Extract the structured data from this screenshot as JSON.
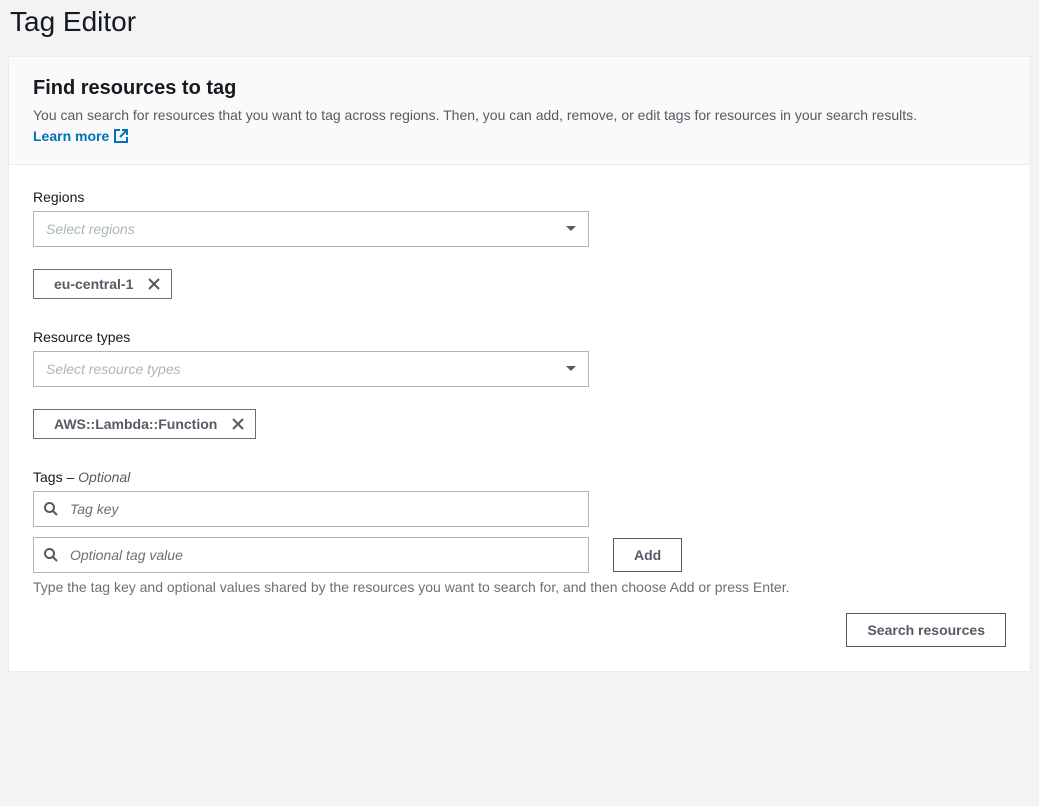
{
  "page": {
    "title": "Tag Editor"
  },
  "header": {
    "title": "Find resources to tag",
    "description": "You can search for resources that you want to tag across regions. Then, you can add, remove, or edit tags for resources in your search results.",
    "learn_more_label": "Learn more"
  },
  "regions": {
    "label": "Regions",
    "placeholder": "Select regions",
    "chips": [
      "eu-central-1"
    ]
  },
  "resource_types": {
    "label": "Resource types",
    "placeholder": "Select resource types",
    "chips": [
      "AWS::Lambda::Function"
    ]
  },
  "tags": {
    "label_prefix": "Tags – ",
    "label_optional": "Optional",
    "key_placeholder": "Tag key",
    "value_placeholder": "Optional tag value",
    "add_label": "Add",
    "help_text": "Type the tag key and optional values shared by the resources you want to search for, and then choose Add or press Enter."
  },
  "actions": {
    "search_label": "Search resources"
  }
}
